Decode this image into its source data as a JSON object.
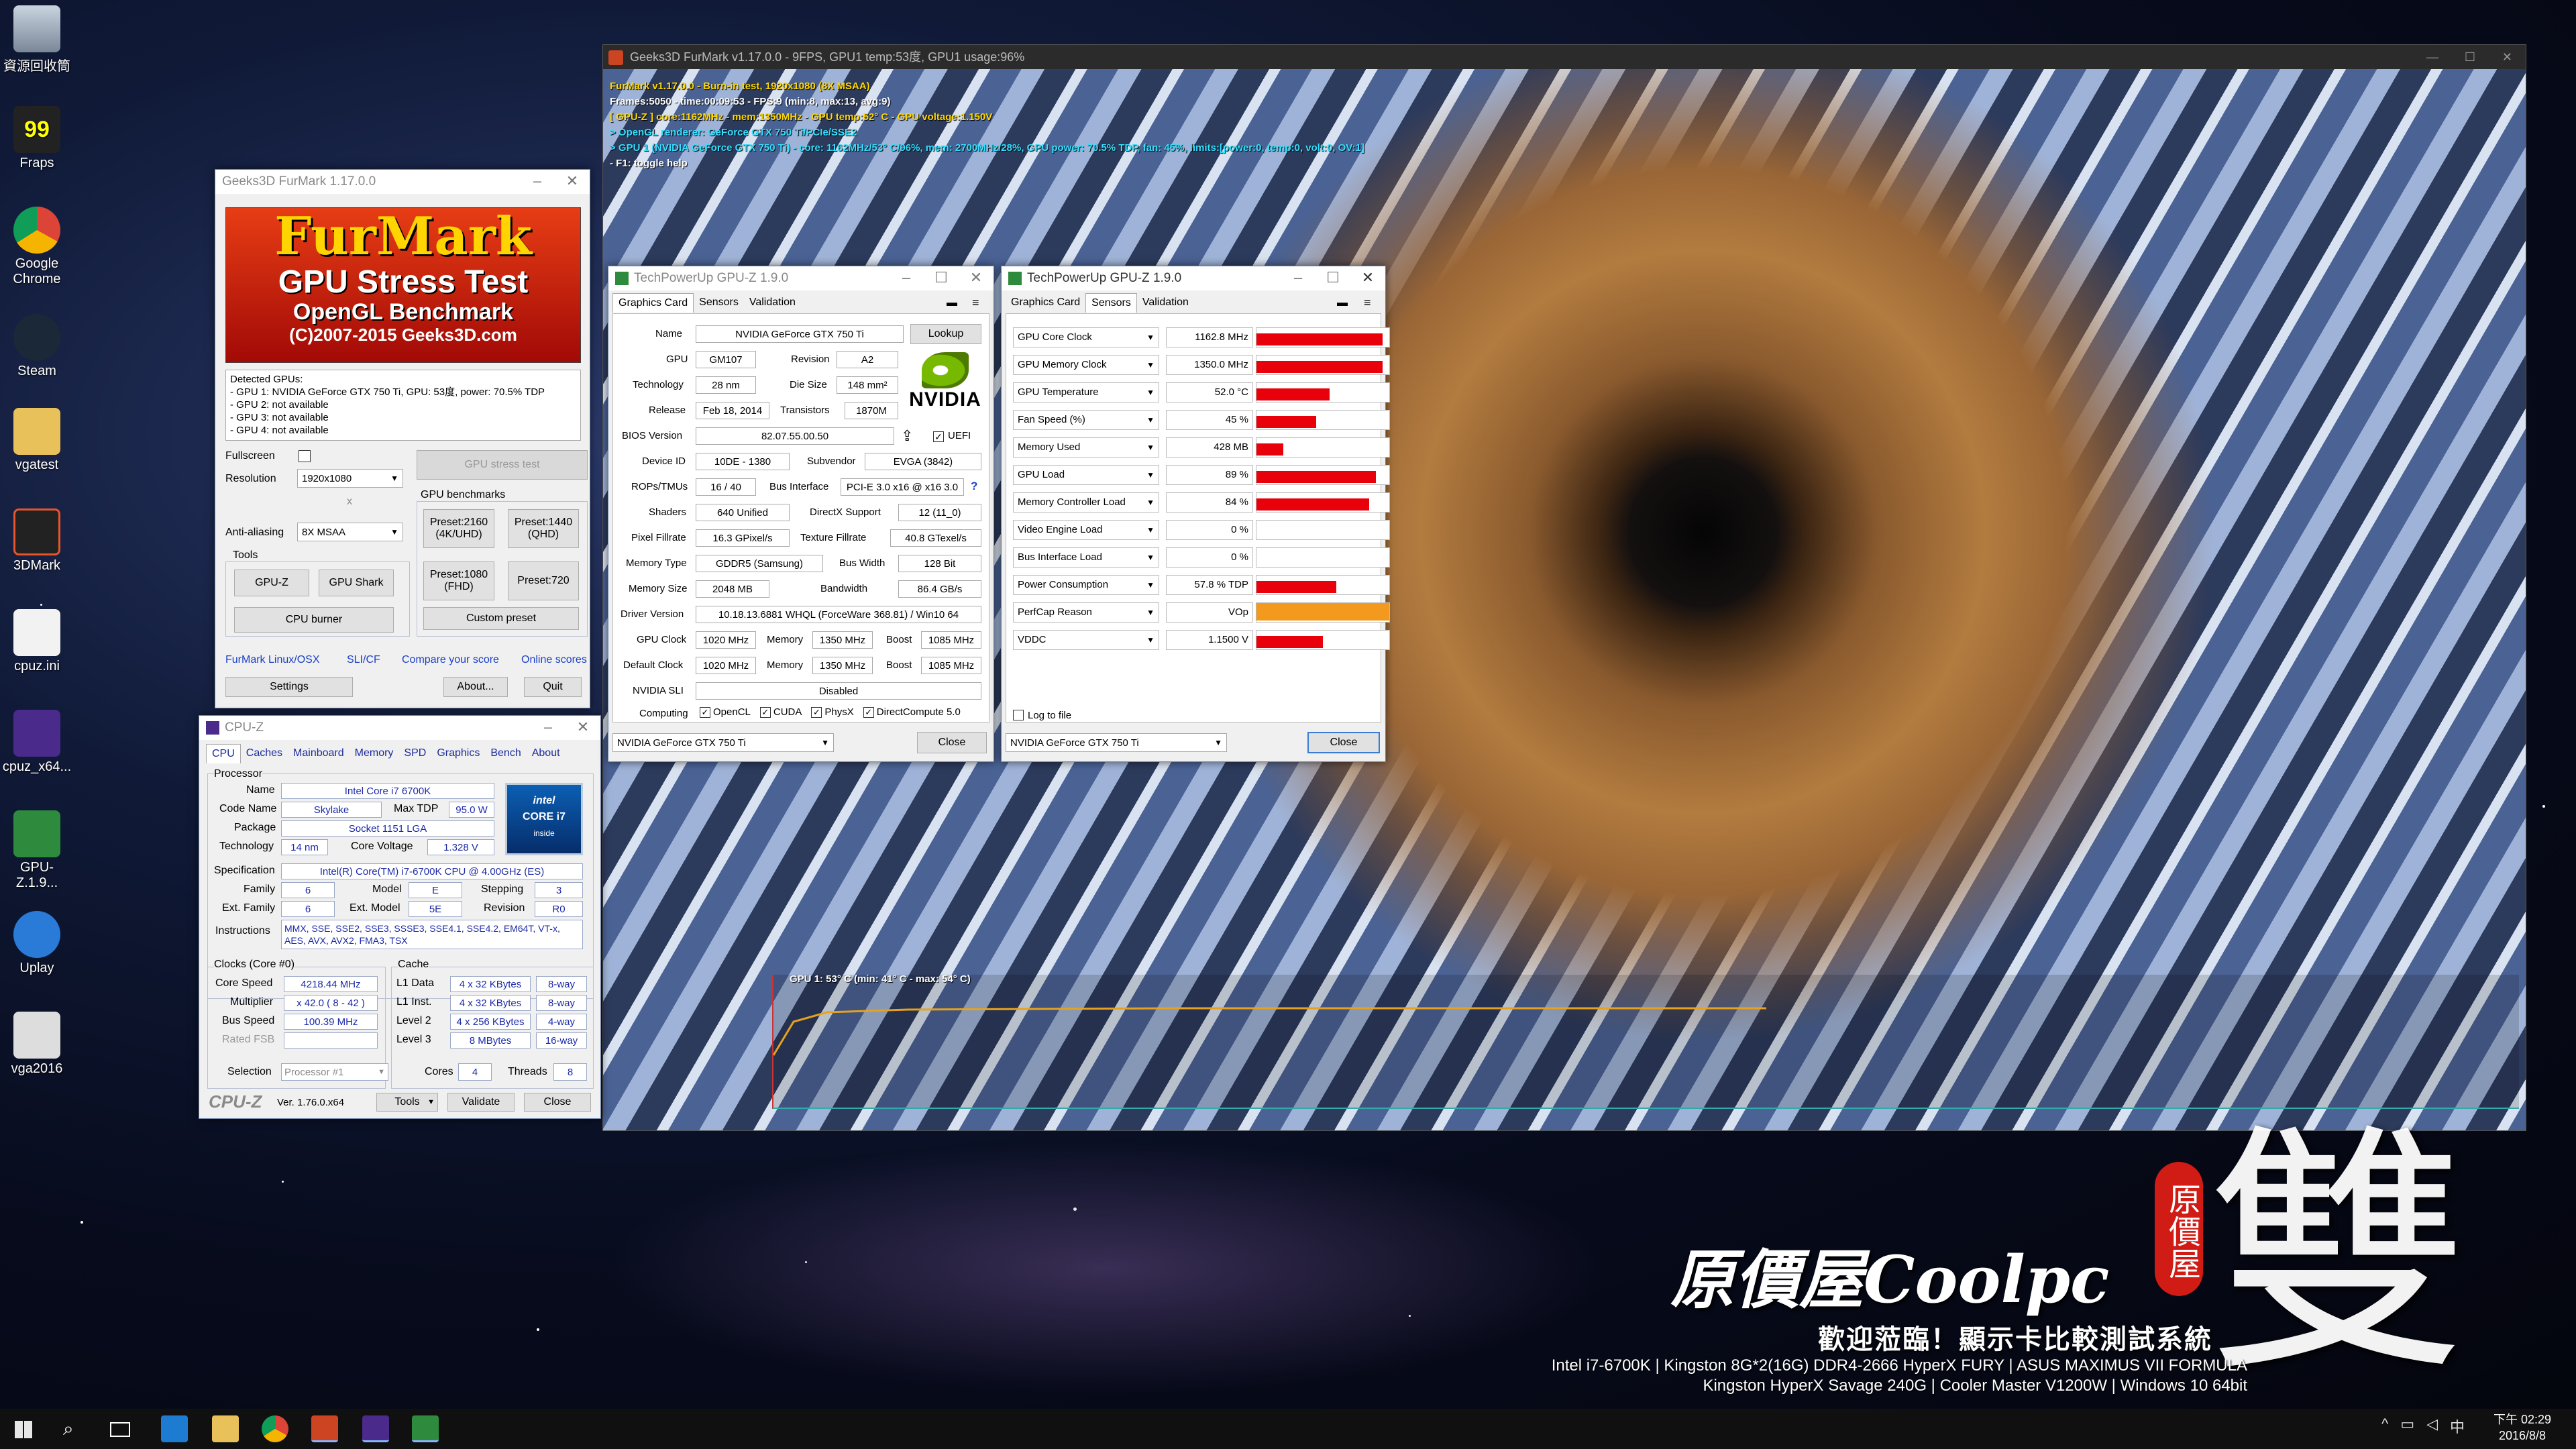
{
  "desktop": {
    "icons": [
      "資源回收筒",
      "Fraps",
      "Google Chrome",
      "Steam",
      "vgatest",
      "3DMark",
      "cpuz.ini",
      "cpuz_x64...",
      "GPU-Z.1.9...",
      "Uplay",
      "vga2016"
    ]
  },
  "furmark_render": {
    "title": "Geeks3D FurMark v1.17.0.0 - 9FPS, GPU1 temp:53度, GPU1 usage:96%",
    "overlay": [
      "FurMark v1.17.0.0 - Burn-in test, 1920x1080 (8X MSAA)",
      "Frames:5050 - time:00:09:53 - FPS:9 (min:8, max:13, avg:9)",
      "[ GPU-Z ] core:1162MHz - mem:1350MHz - GPU temp:52° C - GPU voltage:1.150V",
      "> OpenGL renderer: GeForce GTX 750 Ti/PCIe/SSE2",
      "> GPU 1 (NVIDIA GeForce GTX 750 Ti) - core: 1162MHz/53° C/96%, mem: 2700MHz/28%, GPU power: 70.5% TDP, fan: 45%, limits:[power:0, temp:0, volt:0, OV:1]",
      "- F1: toggle help"
    ],
    "temp_graph_label": "GPU 1: 53° C (min: 41° C - max: 54° C)"
  },
  "furmark_launcher": {
    "title": "Geeks3D FurMark 1.17.0.0",
    "banner": {
      "line1": "FurMark",
      "line2": "GPU Stress Test",
      "line3": "OpenGL Benchmark",
      "line4": "(C)2007-2015 Geeks3D.com"
    },
    "detected_header": "Detected GPUs:",
    "detected": [
      "- GPU 1: NVIDIA GeForce GTX 750 Ti, GPU: 53度, power: 70.5% TDP",
      "- GPU 2: not available",
      "- GPU 3: not available",
      "- GPU 4: not available"
    ],
    "fullscreen": "Fullscreen",
    "resolution_label": "Resolution",
    "resolution": "1920x1080",
    "x": "x",
    "aa_label": "Anti-aliasing",
    "aa": "8X MSAA",
    "stress_btn": "GPU stress test",
    "benchmarks": "GPU benchmarks",
    "p2160": "Preset:2160 (4K/UHD)",
    "p1440": "Preset:1440 (QHD)",
    "p1080": "Preset:1080 (FHD)",
    "p720": "Preset:720",
    "custom": "Custom preset",
    "tools": "Tools",
    "gpuz": "GPU-Z",
    "gpushark": "GPU Shark",
    "cpuburner": "CPU burner",
    "links": [
      "FurMark Linux/OSX",
      "SLI/CF",
      "Compare your score",
      "Online scores"
    ],
    "settings": "Settings",
    "about": "About...",
    "quit": "Quit"
  },
  "gpuz1": {
    "title": "TechPowerUp GPU-Z 1.9.0",
    "tabs": [
      "Graphics Card",
      "Sensors",
      "Validation"
    ],
    "name_l": "Name",
    "name": "NVIDIA GeForce GTX 750 Ti",
    "lookup": "Lookup",
    "gpu_l": "GPU",
    "gpu": "GM107",
    "rev_l": "Revision",
    "rev": "A2",
    "tech_l": "Technology",
    "tech": "28 nm",
    "die_l": "Die Size",
    "die": "148 mm²",
    "rel_l": "Release",
    "rel": "Feb 18, 2014",
    "tr_l": "Transistors",
    "tr": "1870M",
    "bios_l": "BIOS Version",
    "bios": "82.07.55.00.50",
    "uefi": "UEFI",
    "dev_l": "Device ID",
    "dev": "10DE - 1380",
    "sub_l": "Subvendor",
    "sub": "EVGA (3842)",
    "rops_l": "ROPs/TMUs",
    "rops": "16 / 40",
    "bus_l": "Bus Interface",
    "bus": "PCI-E 3.0 x16 @ x16 3.0",
    "q": "?",
    "sh_l": "Shaders",
    "sh": "640 Unified",
    "dx_l": "DirectX Support",
    "dx": "12 (11_0)",
    "pf_l": "Pixel Fillrate",
    "pf": "16.3 GPixel/s",
    "tf_l": "Texture Fillrate",
    "tf": "40.8 GTexel/s",
    "mt_l": "Memory Type",
    "mt": "GDDR5 (Samsung)",
    "bw_l": "Bus Width",
    "bw": "128 Bit",
    "ms_l": "Memory Size",
    "ms": "2048 MB",
    "band_l": "Bandwidth",
    "band": "86.4 GB/s",
    "drv_l": "Driver Version",
    "drv": "10.18.13.6881 WHQL (ForceWare 368.81) / Win10 64",
    "gc_l": "GPU Clock",
    "gc": "1020 MHz",
    "mem_l": "Memory",
    "mem": "1350 MHz",
    "boost_l": "Boost",
    "boost": "1085 MHz",
    "dc_l": "Default Clock",
    "dc": "1020 MHz",
    "mem2": "1350 MHz",
    "boost2": "1085 MHz",
    "sli_l": "NVIDIA SLI",
    "sli": "Disabled",
    "comp_l": "Computing",
    "opencl": "OpenCL",
    "cuda": "CUDA",
    "physx": "PhysX",
    "dc5": "DirectCompute 5.0",
    "sel": "NVIDIA GeForce GTX 750 Ti",
    "close": "Close",
    "nvidia": "NVIDIA"
  },
  "gpuz2": {
    "title": "TechPowerUp GPU-Z 1.9.0",
    "tabs": [
      "Graphics Card",
      "Sensors",
      "Validation"
    ],
    "sensors": [
      {
        "name": "GPU Core Clock",
        "value": "1162.8 MHz",
        "level": 0.95
      },
      {
        "name": "GPU Memory Clock",
        "value": "1350.0 MHz",
        "level": 0.95
      },
      {
        "name": "GPU Temperature",
        "value": "52.0 °C",
        "level": 0.55
      },
      {
        "name": "Fan Speed (%)",
        "value": "45 %",
        "level": 0.45
      },
      {
        "name": "Memory Used",
        "value": "428 MB",
        "level": 0.2
      },
      {
        "name": "GPU Load",
        "value": "89 %",
        "level": 0.9
      },
      {
        "name": "Memory Controller Load",
        "value": "84 %",
        "level": 0.85
      },
      {
        "name": "Video Engine Load",
        "value": "0 %",
        "level": 0
      },
      {
        "name": "Bus Interface Load",
        "value": "0 %",
        "level": 0
      },
      {
        "name": "Power Consumption",
        "value": "57.8 % TDP",
        "level": 0.6
      },
      {
        "name": "PerfCap Reason",
        "value": "VOp",
        "level": 1
      },
      {
        "name": "VDDC",
        "value": "1.1500 V",
        "level": 0.5
      }
    ],
    "log": "Log to file",
    "sel": "NVIDIA GeForce GTX 750 Ti",
    "close": "Close",
    "perfcap_color": "#f39a1e"
  },
  "cpuz": {
    "title": "CPU-Z",
    "tabs": [
      "CPU",
      "Caches",
      "Mainboard",
      "Memory",
      "SPD",
      "Graphics",
      "Bench",
      "About"
    ],
    "processor": "Processor",
    "name_l": "Name",
    "name": "Intel Core i7 6700K",
    "code_l": "Code Name",
    "code": "Skylake",
    "tdp_l": "Max TDP",
    "tdp": "95.0 W",
    "pkg_l": "Package",
    "pkg": "Socket 1151 LGA",
    "tech_l": "Technology",
    "tech": "14 nm",
    "cv_l": "Core Voltage",
    "cv": "1.328 V",
    "spec_l": "Specification",
    "spec": "Intel(R) Core(TM) i7-6700K CPU @ 4.00GHz (ES)",
    "fam_l": "Family",
    "fam": "6",
    "model_l": "Model",
    "model": "E",
    "step_l": "Stepping",
    "step": "3",
    "efam_l": "Ext. Family",
    "efam": "6",
    "emod_l": "Ext. Model",
    "emod": "5E",
    "rev_l": "Revision",
    "rev": "R0",
    "ins_l": "Instructions",
    "ins": "MMX, SSE, SSE2, SSE3, SSSE3, SSE4.1, SSE4.2, EM64T, VT-x, AES, AVX, AVX2, FMA3, TSX",
    "clocks": "Clocks (Core #0)",
    "cache": "Cache",
    "cs_l": "Core Speed",
    "cs": "4218.44 MHz",
    "l1d_l": "L1 Data",
    "l1d": "4 x 32 KBytes",
    "l1d_w": "8-way",
    "mul_l": "Multiplier",
    "mul": "x 42.0 ( 8 - 42 )",
    "l1i_l": "L1 Inst.",
    "l1i": "4 x 32 KBytes",
    "l1i_w": "8-way",
    "bs_l": "Bus Speed",
    "bs": "100.39 MHz",
    "l2_l": "Level 2",
    "l2": "4 x 256 KBytes",
    "l2_w": "4-way",
    "fsb_l": "Rated FSB",
    "l3_l": "Level 3",
    "l3": "8 MBytes",
    "l3_w": "16-way",
    "sel_l": "Selection",
    "sel": "Processor #1",
    "cores_l": "Cores",
    "cores": "4",
    "thr_l": "Threads",
    "thr": "8",
    "brand": "CPU-Z",
    "ver": "Ver. 1.76.0.x64",
    "tools": "Tools",
    "validate": "Validate",
    "close": "Close",
    "badge1": "intel",
    "badge2": "CORE i7",
    "badge3": "inside"
  },
  "watermark": {
    "brand": "原價屋Coolpc",
    "seal": "原價屋",
    "big": "雙",
    "welcome": "歡迎蒞臨！顯示卡比較測試系統",
    "spec1": "Intel i7-6700K | Kingston 8G*2(16G) DDR4-2666 HyperX FURY | ASUS MAXIMUS VII FORMULA",
    "spec2": "Kingston HyperX Savage 240G | Cooler Master V1200W | Windows 10 64bit"
  },
  "taskbar": {
    "time": "下午 02:29",
    "date": "2016/8/8"
  }
}
